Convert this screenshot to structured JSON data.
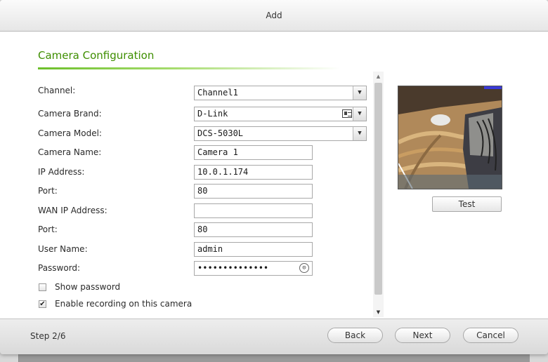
{
  "dialog": {
    "title": "Add"
  },
  "section": {
    "title": "Camera Configuration"
  },
  "form": {
    "channel": {
      "label": "Channel:",
      "value": "Channel1"
    },
    "brand": {
      "label": "Camera Brand:",
      "value": "D-Link"
    },
    "model": {
      "label": "Camera Model:",
      "value": "DCS-5030L"
    },
    "name": {
      "label": "Camera Name:",
      "value": "Camera 1"
    },
    "ip": {
      "label": "IP Address:",
      "value": "10.0.1.174"
    },
    "port": {
      "label": "Port:",
      "value": "80"
    },
    "wan_ip": {
      "label": "WAN IP Address:",
      "value": ""
    },
    "wan_port": {
      "label": "Port:",
      "value": "80"
    },
    "user": {
      "label": "User Name:",
      "value": "admin"
    },
    "password": {
      "label": "Password:",
      "value": "••••••••••••••"
    },
    "show_password": {
      "label": "Show password",
      "checked": false
    },
    "enable_recording": {
      "label": "Enable recording on this camera",
      "checked": true
    }
  },
  "preview": {
    "test_label": "Test"
  },
  "footer": {
    "step": "Step 2/6",
    "back_label": "Back",
    "next_label": "Next",
    "cancel_label": "Cancel"
  },
  "icons": {
    "dropdown": "chevron-down-icon",
    "brand_list": "contact-card-icon",
    "password_reveal": "password-reveal-icon",
    "checkbox_checked": "checkmark-icon"
  },
  "colors": {
    "section_title": "#3e8e00",
    "accent_rule": "#6cbf2a",
    "title_bar": "#eeeeee",
    "footer": "#e3e3e3"
  }
}
